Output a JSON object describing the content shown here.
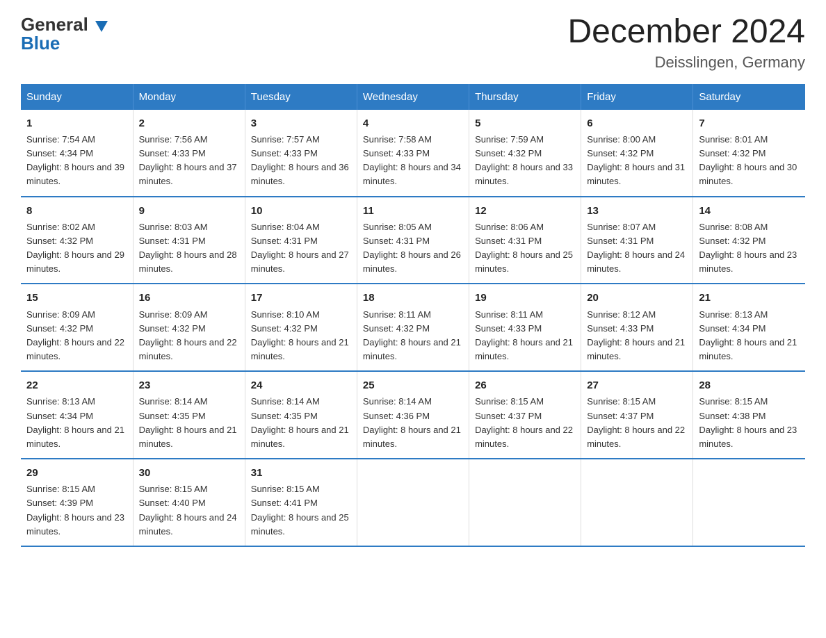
{
  "header": {
    "title": "December 2024",
    "subtitle": "Deisslingen, Germany",
    "logo_general": "General",
    "logo_blue": "Blue"
  },
  "weekdays": [
    "Sunday",
    "Monday",
    "Tuesday",
    "Wednesday",
    "Thursday",
    "Friday",
    "Saturday"
  ],
  "weeks": [
    [
      {
        "day": "1",
        "sunrise": "7:54 AM",
        "sunset": "4:34 PM",
        "daylight": "8 hours and 39 minutes."
      },
      {
        "day": "2",
        "sunrise": "7:56 AM",
        "sunset": "4:33 PM",
        "daylight": "8 hours and 37 minutes."
      },
      {
        "day": "3",
        "sunrise": "7:57 AM",
        "sunset": "4:33 PM",
        "daylight": "8 hours and 36 minutes."
      },
      {
        "day": "4",
        "sunrise": "7:58 AM",
        "sunset": "4:33 PM",
        "daylight": "8 hours and 34 minutes."
      },
      {
        "day": "5",
        "sunrise": "7:59 AM",
        "sunset": "4:32 PM",
        "daylight": "8 hours and 33 minutes."
      },
      {
        "day": "6",
        "sunrise": "8:00 AM",
        "sunset": "4:32 PM",
        "daylight": "8 hours and 31 minutes."
      },
      {
        "day": "7",
        "sunrise": "8:01 AM",
        "sunset": "4:32 PM",
        "daylight": "8 hours and 30 minutes."
      }
    ],
    [
      {
        "day": "8",
        "sunrise": "8:02 AM",
        "sunset": "4:32 PM",
        "daylight": "8 hours and 29 minutes."
      },
      {
        "day": "9",
        "sunrise": "8:03 AM",
        "sunset": "4:31 PM",
        "daylight": "8 hours and 28 minutes."
      },
      {
        "day": "10",
        "sunrise": "8:04 AM",
        "sunset": "4:31 PM",
        "daylight": "8 hours and 27 minutes."
      },
      {
        "day": "11",
        "sunrise": "8:05 AM",
        "sunset": "4:31 PM",
        "daylight": "8 hours and 26 minutes."
      },
      {
        "day": "12",
        "sunrise": "8:06 AM",
        "sunset": "4:31 PM",
        "daylight": "8 hours and 25 minutes."
      },
      {
        "day": "13",
        "sunrise": "8:07 AM",
        "sunset": "4:31 PM",
        "daylight": "8 hours and 24 minutes."
      },
      {
        "day": "14",
        "sunrise": "8:08 AM",
        "sunset": "4:32 PM",
        "daylight": "8 hours and 23 minutes."
      }
    ],
    [
      {
        "day": "15",
        "sunrise": "8:09 AM",
        "sunset": "4:32 PM",
        "daylight": "8 hours and 22 minutes."
      },
      {
        "day": "16",
        "sunrise": "8:09 AM",
        "sunset": "4:32 PM",
        "daylight": "8 hours and 22 minutes."
      },
      {
        "day": "17",
        "sunrise": "8:10 AM",
        "sunset": "4:32 PM",
        "daylight": "8 hours and 21 minutes."
      },
      {
        "day": "18",
        "sunrise": "8:11 AM",
        "sunset": "4:32 PM",
        "daylight": "8 hours and 21 minutes."
      },
      {
        "day": "19",
        "sunrise": "8:11 AM",
        "sunset": "4:33 PM",
        "daylight": "8 hours and 21 minutes."
      },
      {
        "day": "20",
        "sunrise": "8:12 AM",
        "sunset": "4:33 PM",
        "daylight": "8 hours and 21 minutes."
      },
      {
        "day": "21",
        "sunrise": "8:13 AM",
        "sunset": "4:34 PM",
        "daylight": "8 hours and 21 minutes."
      }
    ],
    [
      {
        "day": "22",
        "sunrise": "8:13 AM",
        "sunset": "4:34 PM",
        "daylight": "8 hours and 21 minutes."
      },
      {
        "day": "23",
        "sunrise": "8:14 AM",
        "sunset": "4:35 PM",
        "daylight": "8 hours and 21 minutes."
      },
      {
        "day": "24",
        "sunrise": "8:14 AM",
        "sunset": "4:35 PM",
        "daylight": "8 hours and 21 minutes."
      },
      {
        "day": "25",
        "sunrise": "8:14 AM",
        "sunset": "4:36 PM",
        "daylight": "8 hours and 21 minutes."
      },
      {
        "day": "26",
        "sunrise": "8:15 AM",
        "sunset": "4:37 PM",
        "daylight": "8 hours and 22 minutes."
      },
      {
        "day": "27",
        "sunrise": "8:15 AM",
        "sunset": "4:37 PM",
        "daylight": "8 hours and 22 minutes."
      },
      {
        "day": "28",
        "sunrise": "8:15 AM",
        "sunset": "4:38 PM",
        "daylight": "8 hours and 23 minutes."
      }
    ],
    [
      {
        "day": "29",
        "sunrise": "8:15 AM",
        "sunset": "4:39 PM",
        "daylight": "8 hours and 23 minutes."
      },
      {
        "day": "30",
        "sunrise": "8:15 AM",
        "sunset": "4:40 PM",
        "daylight": "8 hours and 24 minutes."
      },
      {
        "day": "31",
        "sunrise": "8:15 AM",
        "sunset": "4:41 PM",
        "daylight": "8 hours and 25 minutes."
      },
      null,
      null,
      null,
      null
    ]
  ],
  "labels": {
    "sunrise": "Sunrise: ",
    "sunset": "Sunset: ",
    "daylight": "Daylight: "
  }
}
